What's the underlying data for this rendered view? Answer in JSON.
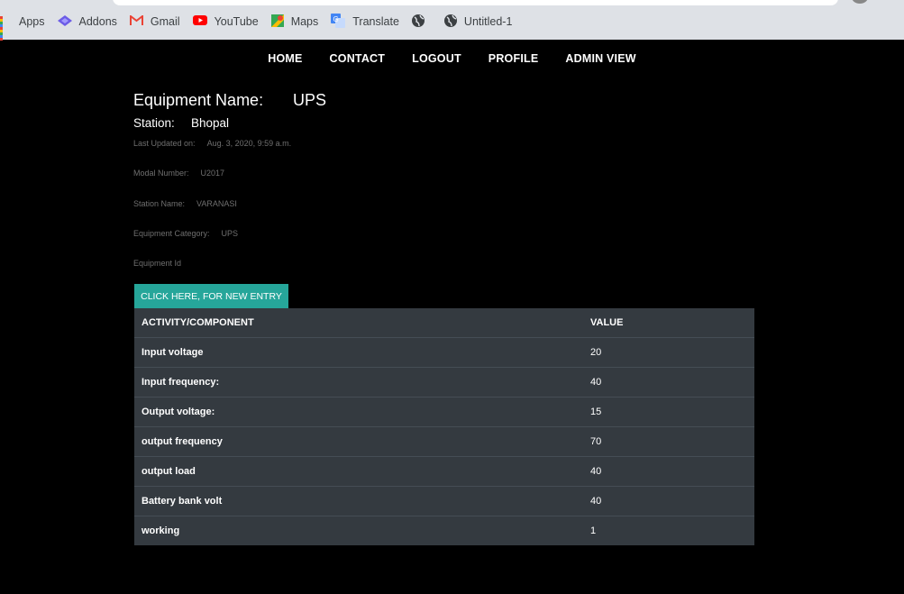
{
  "bookmarks": [
    {
      "label": "Apps",
      "icon": "apps-grid-icon"
    },
    {
      "label": "Addons",
      "icon": "addons-icon"
    },
    {
      "label": "Gmail",
      "icon": "gmail-icon"
    },
    {
      "label": "YouTube",
      "icon": "youtube-icon"
    },
    {
      "label": "Maps",
      "icon": "maps-icon"
    },
    {
      "label": "Translate",
      "icon": "translate-icon"
    },
    {
      "label": "",
      "icon": "globe-icon"
    },
    {
      "label": "Untitled-1",
      "icon": "globe-icon"
    }
  ],
  "nav": {
    "home": "HOME",
    "contact": "CONTACT",
    "logout": "LOGOUT",
    "profile": "PROFILE",
    "admin": "ADMIN VIEW"
  },
  "equipment": {
    "name_label": "Equipment Name:",
    "name": "UPS",
    "station_label": "Station:",
    "station": "Bhopal",
    "updated_label": "Last Updated on:",
    "updated": "Aug. 3, 2020, 9:59 a.m.",
    "model_label": "Modal Number:",
    "model": "U2017",
    "station_name_label": "Station Name:",
    "station_name": "VARANASI",
    "category_label": "Equipment Category:",
    "category": "UPS",
    "id_label": "Equipment Id"
  },
  "new_entry_button": "CLICK HERE, FOR NEW ENTRY",
  "table": {
    "headers": [
      "ACTIVITY/COMPONENT",
      "VALUE"
    ],
    "rows": [
      [
        "Input voltage",
        "20"
      ],
      [
        "Input frequency:",
        "40"
      ],
      [
        "Output voltage:",
        "15"
      ],
      [
        "output frequency",
        "70"
      ],
      [
        "output load",
        "40"
      ],
      [
        "Battery bank volt",
        "40"
      ],
      [
        "working",
        "1"
      ]
    ]
  }
}
